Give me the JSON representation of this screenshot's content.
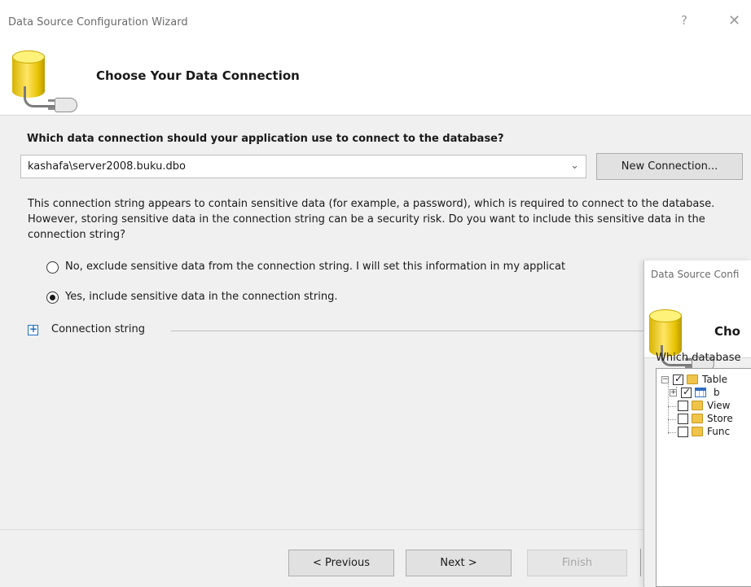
{
  "window": {
    "title": "Data Source Configuration Wizard",
    "help_glyph": "?",
    "close_glyph": "✕"
  },
  "header": {
    "title": "Choose Your Data Connection",
    "icon": "database-plug-icon"
  },
  "connection": {
    "question": "Which data connection should your application use to connect to the database?",
    "selected": "kashafa\\server2008.buku.dbo",
    "new_connection_label": "New Connection..."
  },
  "sensitive": {
    "message": "This connection string appears to contain sensitive data (for example, a password), which is required to connect to the database. However, storing sensitive data in the connection string can be a security risk. Do you want to include this sensitive data in the connection string?",
    "option_no": "No, exclude sensitive data from the connection string. I will set this information in my applicat",
    "option_yes": "Yes, include sensitive data in the connection string.",
    "selected_option": "yes"
  },
  "connection_string": {
    "label": "Connection string",
    "expander_glyph": "+"
  },
  "footer": {
    "previous_label": "< Previous",
    "next_label": "Next >",
    "finish_label": "Finish"
  },
  "second_window": {
    "title": "Data Source Confi",
    "header_title": "Cho",
    "question": "Which database",
    "tree": [
      {
        "label": "Table",
        "checked": true,
        "expander": "−"
      },
      {
        "label": "b",
        "checked": true,
        "expander": "+"
      },
      {
        "label": "View",
        "checked": false
      },
      {
        "label": "Store",
        "checked": false
      },
      {
        "label": "Func",
        "checked": false
      }
    ]
  },
  "colors": {
    "accent": "#1f6fbf",
    "disabled_text": "#a6a6a6",
    "panel_bg": "#f0f0f0"
  }
}
